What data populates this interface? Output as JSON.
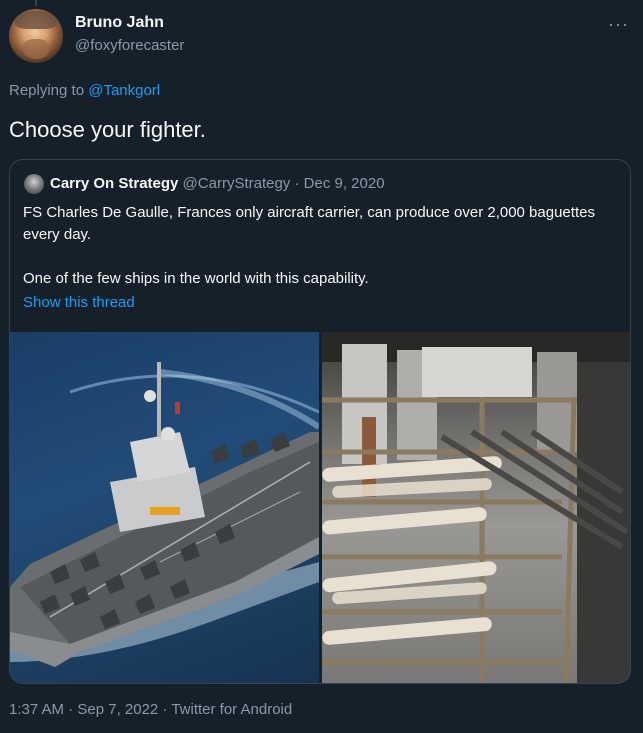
{
  "author": {
    "name": "Bruno Jahn",
    "handle": "@foxyforecaster",
    "more_icon": "···"
  },
  "reply_context": {
    "prefix": "Replying to ",
    "mention": "@Tankgorl"
  },
  "tweet": {
    "text": "Choose your fighter."
  },
  "quoted_tweet": {
    "name": "Carry On Strategy",
    "meta": " @CarryStrategy · Dec 9, 2020",
    "line1": "FS Charles De Gaulle, Frances only aircraft carrier, can produce over 2,000 baguettes every day.",
    "line2": "One of the few ships in the world with this capability.",
    "show_thread": "Show this thread"
  },
  "footer": {
    "timestamp": "1:37 AM · Sep 7, 2022 · Twitter for Android"
  },
  "colors": {
    "background": "#15202b",
    "text": "#f7f9f9",
    "secondary": "#8b98a5",
    "link": "#1d9bf0",
    "border": "#38444d"
  }
}
